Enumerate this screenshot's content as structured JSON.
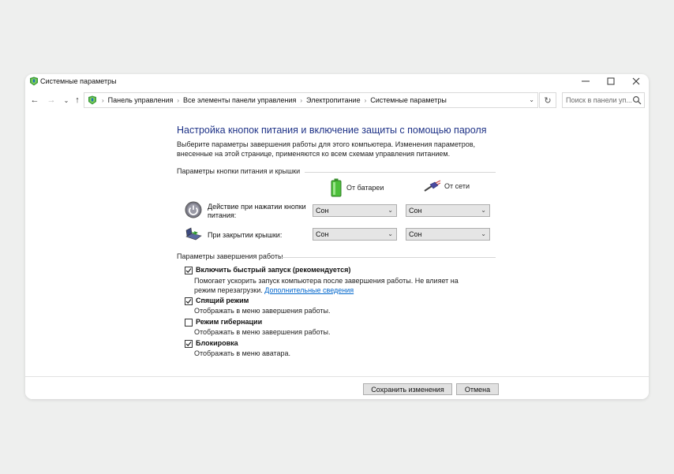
{
  "window": {
    "title": "Системные параметры"
  },
  "nav": {
    "breadcrumb": [
      "Панель управления",
      "Все элементы панели управления",
      "Электропитание",
      "Системные параметры"
    ],
    "search_placeholder": "Поиск в панели уп..."
  },
  "page": {
    "title": "Настройка кнопок питания и включение защиты с помощью пароля",
    "description": "Выберите параметры завершения работы для этого компьютера. Изменения параметров, внесенные на этой странице, применяются ко всем схемам управления питанием."
  },
  "power_section": {
    "heading": "Параметры кнопки питания и крышки",
    "col_battery": "От батареи",
    "col_ac": "От сети",
    "rows": [
      {
        "label": "Действие при нажатии кнопки питания:",
        "battery": "Сон",
        "ac": "Сон"
      },
      {
        "label": "При закрытии крышки:",
        "battery": "Сон",
        "ac": "Сон"
      }
    ]
  },
  "shutdown_section": {
    "heading": "Параметры завершения работы",
    "options": [
      {
        "label": "Включить быстрый запуск (рекомендуется)",
        "checked": true,
        "desc": "Помогает ускорить запуск компьютера после завершения работы. Не влияет на режим перезагрузки.",
        "link": "Дополнительные сведения"
      },
      {
        "label": "Спящий режим",
        "checked": true,
        "desc": "Отображать в меню завершения работы."
      },
      {
        "label": "Режим гибернации",
        "checked": false,
        "desc": "Отображать в меню завершения работы."
      },
      {
        "label": "Блокировка",
        "checked": true,
        "desc": "Отображать в меню аватара."
      }
    ]
  },
  "footer": {
    "save": "Сохранить изменения",
    "cancel": "Отмена"
  },
  "icons": {
    "app": "control-panel-icon",
    "back": "arrow-left-icon",
    "forward": "arrow-right-icon",
    "recent": "chevron-down-icon",
    "up": "arrow-up-icon",
    "refresh": "refresh-icon",
    "search": "search-icon"
  }
}
